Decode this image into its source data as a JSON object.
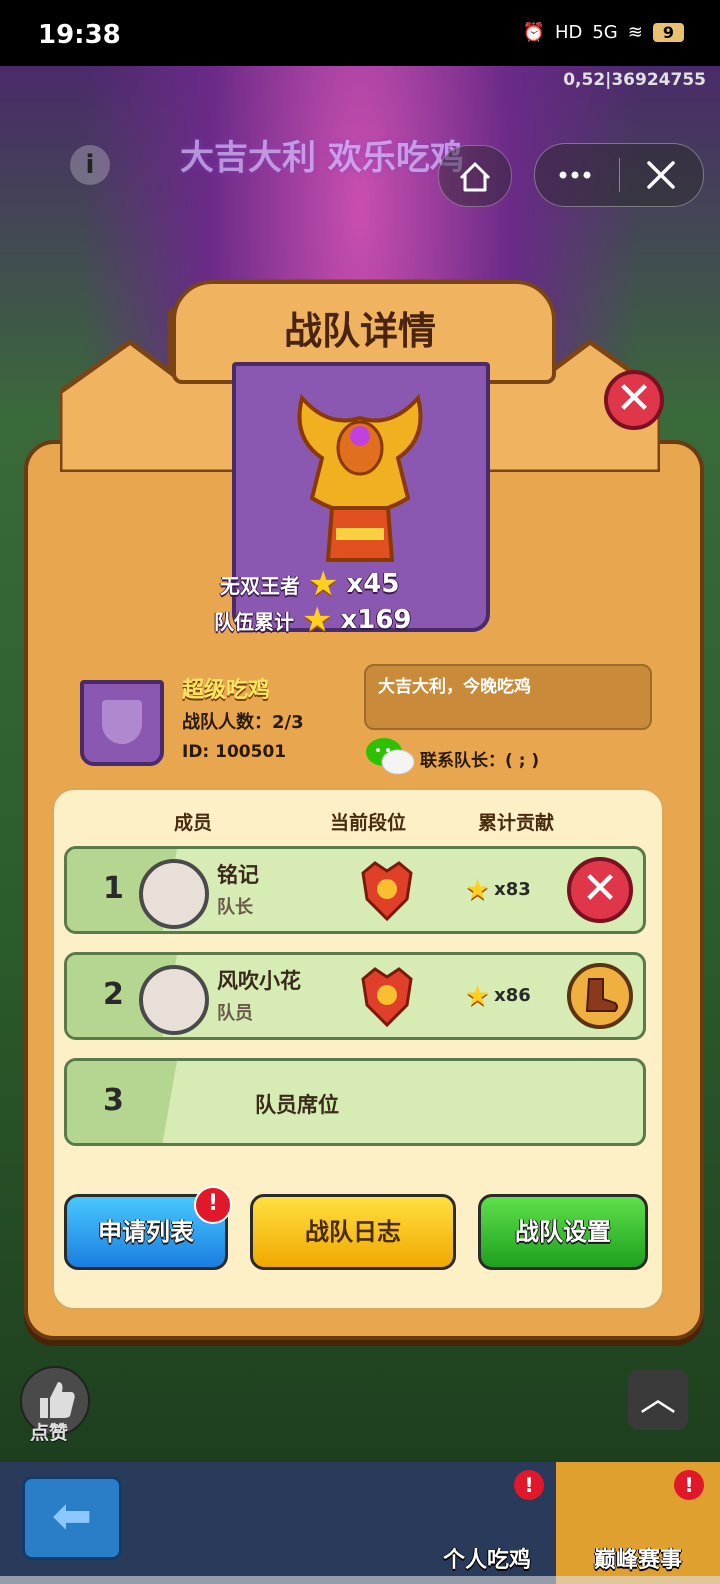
{
  "status_bar": {
    "time": "19:38",
    "network": "5G",
    "hd": "HD",
    "battery": "9"
  },
  "background": {
    "banner": "大吉大利 欢乐吃鸡",
    "code": "0,52|36924755"
  },
  "modal": {
    "title": "战队详情",
    "emblem_stats": {
      "rank_name": "无双王者",
      "rank_stars": "x45",
      "team_total_label": "队伍累计",
      "team_total_stars": "x169"
    },
    "team": {
      "name": "超级吃鸡",
      "count": "战队人数：2/3",
      "id": "ID: 100501",
      "motto": "大吉大利，今晚吃鸡",
      "contact": "联系队长：( ; )"
    },
    "table": {
      "headers": [
        "成员",
        "当前段位",
        "累计贡献"
      ],
      "rows": [
        {
          "rank": "1",
          "name": "铭记",
          "role": "队长",
          "contrib": "x83"
        },
        {
          "rank": "2",
          "name": "风吹小花",
          "role": "队员",
          "contrib": "x86"
        },
        {
          "rank": "3",
          "seat": "队员席位"
        }
      ]
    },
    "buttons": {
      "apply_list": "申请列表",
      "team_log": "战队日志",
      "team_settings": "战队设置",
      "apply_badge": "!"
    }
  },
  "bottom": {
    "like": "点赞",
    "tab1": "个人吃鸡",
    "tab2": "巅峰赛事",
    "tab_badge": "!"
  },
  "colors": {
    "panel": "#e8a64e",
    "close_red": "#e0364a",
    "row_green": "#d6ecb4"
  }
}
